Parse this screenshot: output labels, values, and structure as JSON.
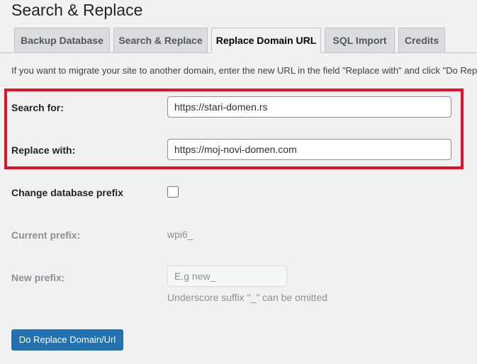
{
  "page": {
    "title": "Search & Replace"
  },
  "tabs": [
    {
      "label": "Backup Database",
      "active": false
    },
    {
      "label": "Search & Replace",
      "active": false
    },
    {
      "label": "Replace Domain URL",
      "active": true
    },
    {
      "label": "SQL Import",
      "active": false
    },
    {
      "label": "Credits",
      "active": false
    }
  ],
  "intro": {
    "text": "If you want to migrate your site to another domain, enter the new URL in the field \"Replace with\" and click \"Do Rep"
  },
  "form": {
    "search_for": {
      "label": "Search for:",
      "value": "https://stari-domen.rs"
    },
    "replace_with": {
      "label": "Replace with:",
      "value": "https://moj-novi-domen.com"
    },
    "change_prefix": {
      "label": "Change database prefix",
      "checked": false
    },
    "current_prefix": {
      "label": "Current prefix:",
      "value": "wpi6_"
    },
    "new_prefix": {
      "label": "New prefix:",
      "placeholder": "E.g new_",
      "help": "Underscore suffix \"_\" can be omitted"
    },
    "submit_label": "Do Replace Domain/Url"
  },
  "colors": {
    "highlight_border": "#e3112a",
    "primary_button": "#2271b1",
    "background": "#f1f1f1"
  }
}
